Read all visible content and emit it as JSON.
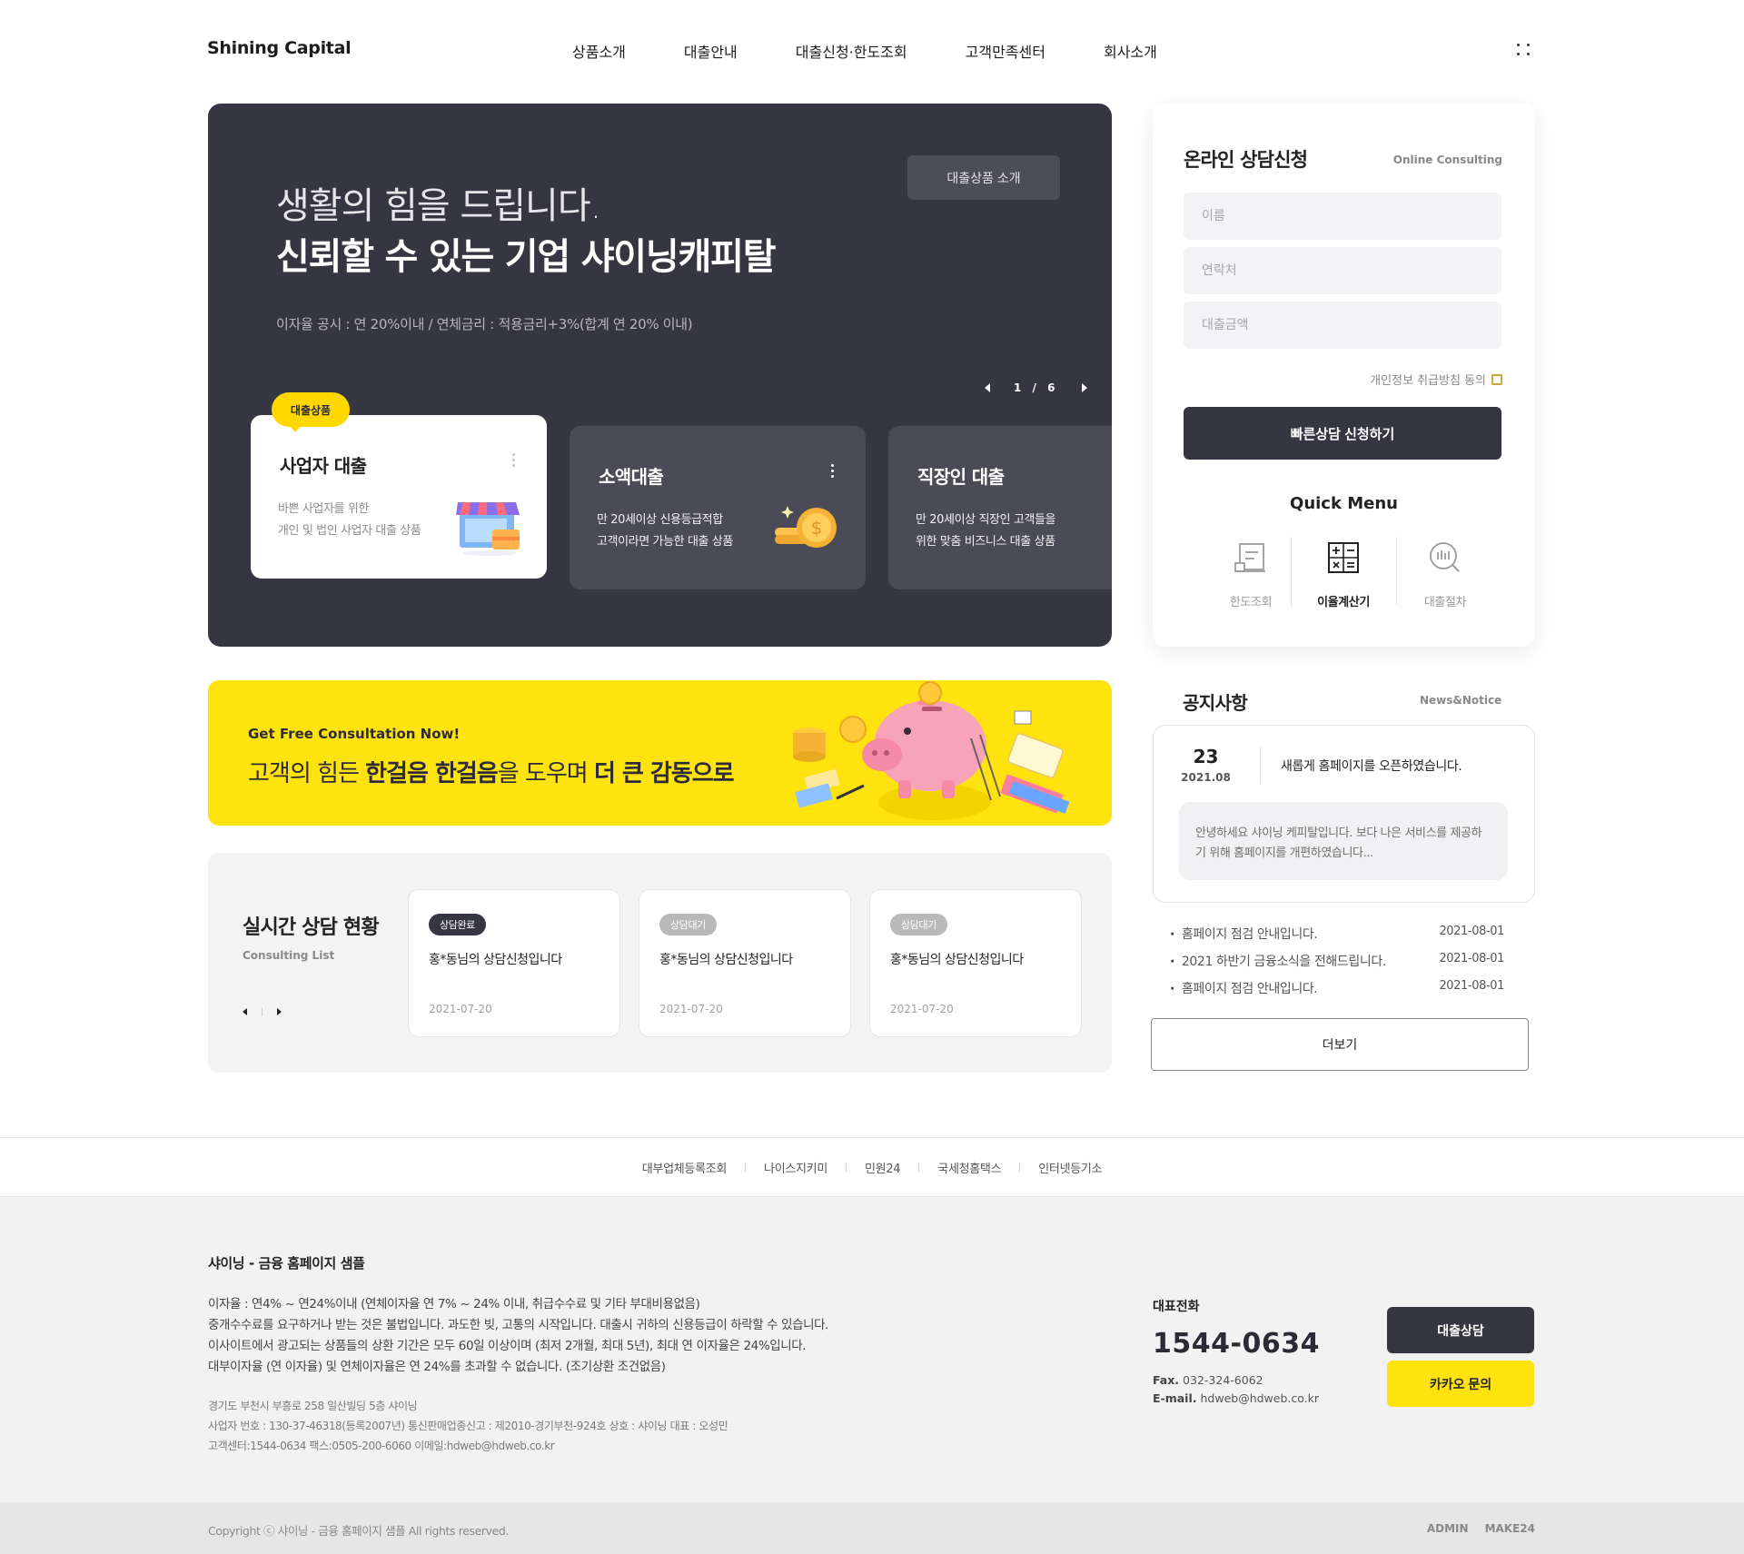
{
  "header": {
    "logo": "Shining Capital",
    "nav": [
      "상품소개",
      "대출안내",
      "대출신청·한도조회",
      "고객만족센터",
      "회사소개"
    ],
    "menu_icon": "grid-dots-icon"
  },
  "hero": {
    "line1": "생활의 힘을 드립니다.",
    "line2": "신뢰할 수 있는 기업 샤이닝캐피탈",
    "note": "이자율 공시 : 연 20%이내 / 연체금리 : 적용금리+3%(합계 연 20% 이내)",
    "button": "대출상품 소개",
    "pager": "1 / 6",
    "badge": "대출상품",
    "cards": [
      {
        "title": "사업자 대출",
        "desc1": "바쁜 사업자를 위한",
        "desc2": "개인 및 법인 사업자 대출 상품",
        "icon": "store-icon"
      },
      {
        "title": "소액대출",
        "desc1": "만 20세이상 신용등급적합",
        "desc2": "고객이라면 가능한 대출 상품",
        "icon": "coins-icon"
      },
      {
        "title": "직장인 대출",
        "desc1": "만 20세이상 직장인 고객들을",
        "desc2": "위한 맞춤 비즈니스 대출 상품",
        "icon": ""
      }
    ]
  },
  "consult": {
    "title": "온라인 상담신청",
    "subtitle": "Online Consulting",
    "name_placeholder": "이름",
    "phone_placeholder": "연락처",
    "amount_placeholder": "대출금액",
    "agree": "개인정보 취급방침 동의",
    "submit": "빠른상담 신청하기",
    "quick_title": "Quick Menu",
    "quick": [
      {
        "label": "한도조회",
        "icon": "limit-check-icon"
      },
      {
        "label": "이율계산기",
        "icon": "calculator-icon"
      },
      {
        "label": "대출절차",
        "icon": "process-search-icon"
      }
    ]
  },
  "banner": {
    "sub": "Get Free Consultation Now!",
    "main_pre": "고객의 힘든 ",
    "main_b1": "한걸음 한걸음",
    "main_mid": "을 도우며 ",
    "main_b2": "더 큰 감동으로",
    "illustration": "piggy-bank-illustration"
  },
  "realtime": {
    "title": "실시간 상담 현황",
    "subtitle": "Consulting List",
    "items": [
      {
        "status": "상담완료",
        "text": "홍*동님의 상담신청입니다",
        "date": "2021-07-20"
      },
      {
        "status": "상담대기",
        "text": "홍*동님의 상담신청입니다",
        "date": "2021-07-20"
      },
      {
        "status": "상담대기",
        "text": "홍*동님의 상담신청입니다",
        "date": "2021-07-20"
      }
    ]
  },
  "notice": {
    "title": "공지사항",
    "subtitle": "News&Notice",
    "featured": {
      "day": "23",
      "ym": "2021.08",
      "head": "새롭게 홈페이지를 오픈하였습니다.",
      "body": "안녕하세요 샤이닝 케피탈입니다. 보다 나은 서비스를 제공하기 위해 홈페이지를 개편하였습니다..."
    },
    "list": [
      {
        "title": "홈페이지 점검 안내입니다.",
        "date": "2021-08-01"
      },
      {
        "title": "2021 하반기 금융소식을 전해드립니다.",
        "date": "2021-08-01"
      },
      {
        "title": "홈페이지 점검 안내입니다.",
        "date": "2021-08-01"
      }
    ],
    "more": "더보기"
  },
  "footer_links": [
    "대부업체등록조회",
    "나이스지키미",
    "민원24",
    "국세청홈택스",
    "인터넷등기소"
  ],
  "footer": {
    "title": "샤이닝 - 금융 홈페이지 샘플",
    "legal": [
      "이자율 : 연4% ~ 연24%이내 (연체이자율 연 7% ~ 24% 이내, 취급수수료 및 기타 부대비용없음)",
      "중개수수료를 요구하거나 받는 것은 불법입니다. 과도한 빚, 고통의 시작입니다. 대출시 귀하의 신용등급이 하락할 수 있습니다.",
      "이사이트에서 광고되는 상품들의 상환 기간은 모두 60일 이상이며 (최저 2개월, 최대 5년), 최대 연 이자율은 24%입니다.",
      "대부이자율 (연 이자율) 및 연체이자율은 연 24%를 초과할 수 없습니다. (조기상환 조건없음)"
    ],
    "addr": [
      "경기도 부천시 부흥로 258 일산빌딩 5층 샤이닝",
      "사업자 번호 : 130-37-46318(등록2007년) 통신판매업종신고 : 제2010-경기부천-924호 상호 : 샤이닝 대표 : 오성민",
      "고객센터:1544-0634 팩스:0505-200-6060 이메일:hdweb@hdweb.co.kr"
    ],
    "phone_label": "대표전화",
    "phone": "1544-0634",
    "fax_label": "Fax.",
    "fax": "032-324-6062",
    "email_label": "E-mail.",
    "email": "hdweb@hdweb.co.kr",
    "btn_consult": "대출상담",
    "btn_kakao": "카카오 문의",
    "copyright": "Copyright ⓒ 샤이닝 - 금융 홈페이지 샘플 All rights reserved.",
    "admin": "ADMIN",
    "make": "MAKE24"
  },
  "colors": {
    "accent_yellow": "#ffe30f",
    "dark": "#363542",
    "card_dark": "#4b4a57"
  }
}
